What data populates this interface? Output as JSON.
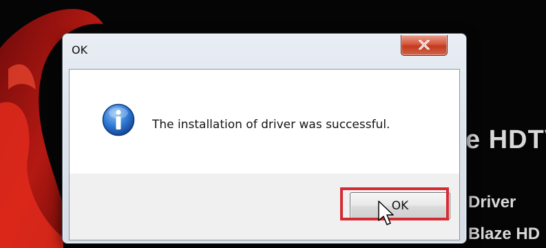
{
  "background": {
    "title": "e HDTV",
    "line1": "Driver",
    "line2": "Blaze HD"
  },
  "dialog": {
    "title": "OK",
    "message": "The installation of driver was successful.",
    "ok_label": "OK",
    "icon": "info-icon",
    "close_icon": "close-icon"
  },
  "colors": {
    "highlight": "#d42a32",
    "close_button": "#c23a1d",
    "info_blue": "#1f5fb8"
  }
}
